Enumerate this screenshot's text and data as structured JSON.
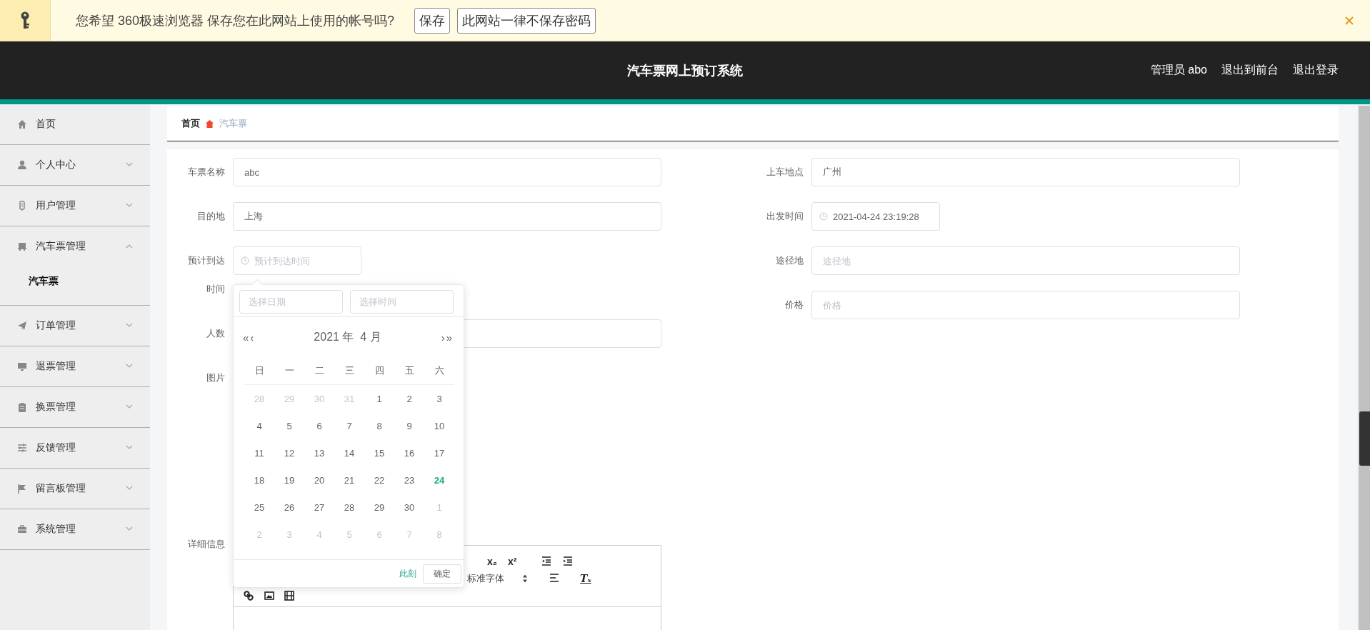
{
  "password_bar": {
    "message": "您希望 360极速浏览器 保存您在此网站上使用的帐号吗?",
    "buttons": [
      "保存",
      "此网站一律不保存密码"
    ]
  },
  "header": {
    "title": "汽车票网上预订系统",
    "links": [
      "管理员 abo",
      "退出到前台",
      "退出登录"
    ]
  },
  "sidebar": {
    "items": [
      {
        "label": "首页",
        "kind": "link"
      },
      {
        "label": "个人中心",
        "kind": "menu",
        "expanded": false
      },
      {
        "label": "用户管理",
        "kind": "menu",
        "expanded": false
      },
      {
        "label": "汽车票管理",
        "kind": "menu",
        "expanded": true,
        "children": [
          {
            "label": "汽车票"
          }
        ]
      },
      {
        "label": "订单管理",
        "kind": "menu",
        "expanded": false
      },
      {
        "label": "退票管理",
        "kind": "menu",
        "expanded": false
      },
      {
        "label": "换票管理",
        "kind": "menu",
        "expanded": false
      },
      {
        "label": "反馈管理",
        "kind": "menu",
        "expanded": false
      },
      {
        "label": "留言板管理",
        "kind": "menu",
        "expanded": false
      },
      {
        "label": "系统管理",
        "kind": "menu",
        "expanded": false
      }
    ]
  },
  "breadcrumb": [
    "首页",
    "汽车票"
  ],
  "form": {
    "left": [
      {
        "label": "车票名称",
        "kind": "text",
        "value": "abc"
      },
      {
        "label": "目的地",
        "kind": "text",
        "value": "上海"
      },
      {
        "label": "预计到达时间",
        "kind": "datetime",
        "placeholder": "预计到达时间",
        "picker": {
          "date_placeholder": "选择日期",
          "time_placeholder": "选择时间",
          "nav_back": [
            "«",
            "‹"
          ],
          "title": "2021 年  4 月",
          "nav_forward": [
            "›",
            "»"
          ],
          "weekdays": [
            "日",
            "一",
            "二",
            "三",
            "四",
            "五",
            "六"
          ],
          "days": [
            {
              "day": "28",
              "muted": true,
              "selected": false
            },
            {
              "day": "29",
              "muted": true,
              "selected": false
            },
            {
              "day": "30",
              "muted": true,
              "selected": false
            },
            {
              "day": "31",
              "muted": true,
              "selected": false
            },
            {
              "day": "1",
              "muted": false,
              "selected": false
            },
            {
              "day": "2",
              "muted": false,
              "selected": false
            },
            {
              "day": "3",
              "muted": false,
              "selected": false
            },
            {
              "day": "4",
              "muted": false,
              "selected": false
            },
            {
              "day": "5",
              "muted": false,
              "selected": false
            },
            {
              "day": "6",
              "muted": false,
              "selected": false
            },
            {
              "day": "7",
              "muted": false,
              "selected": false
            },
            {
              "day": "8",
              "muted": false,
              "selected": false
            },
            {
              "day": "9",
              "muted": false,
              "selected": false
            },
            {
              "day": "10",
              "muted": false,
              "selected": false
            },
            {
              "day": "11",
              "muted": false,
              "selected": false
            },
            {
              "day": "12",
              "muted": false,
              "selected": false
            },
            {
              "day": "13",
              "muted": false,
              "selected": false
            },
            {
              "day": "14",
              "muted": false,
              "selected": false
            },
            {
              "day": "15",
              "muted": false,
              "selected": false
            },
            {
              "day": "16",
              "muted": false,
              "selected": false
            },
            {
              "day": "17",
              "muted": false,
              "selected": false
            },
            {
              "day": "18",
              "muted": false,
              "selected": false
            },
            {
              "day": "19",
              "muted": false,
              "selected": false
            },
            {
              "day": "20",
              "muted": false,
              "selected": false
            },
            {
              "day": "21",
              "muted": false,
              "selected": false
            },
            {
              "day": "22",
              "muted": false,
              "selected": false
            },
            {
              "day": "23",
              "muted": false,
              "selected": false
            },
            {
              "day": "24",
              "muted": false,
              "selected": true
            },
            {
              "day": "25",
              "muted": false,
              "selected": false
            },
            {
              "day": "26",
              "muted": false,
              "selected": false
            },
            {
              "day": "27",
              "muted": false,
              "selected": false
            },
            {
              "day": "28",
              "muted": false,
              "selected": false
            },
            {
              "day": "29",
              "muted": false,
              "selected": false
            },
            {
              "day": "30",
              "muted": false,
              "selected": false
            },
            {
              "day": "1",
              "muted": true,
              "selected": false
            },
            {
              "day": "2",
              "muted": true,
              "selected": false
            },
            {
              "day": "3",
              "muted": true,
              "selected": false
            },
            {
              "day": "4",
              "muted": true,
              "selected": false
            },
            {
              "day": "5",
              "muted": true,
              "selected": false
            },
            {
              "day": "6",
              "muted": true,
              "selected": false
            },
            {
              "day": "7",
              "muted": true,
              "selected": false
            },
            {
              "day": "8",
              "muted": true,
              "selected": false
            }
          ],
          "now_link": "此刻",
          "confirm": "确定"
        }
      },
      {
        "label": "人数",
        "kind": "text"
      },
      {
        "label": "图片",
        "kind": "upload"
      },
      {
        "label": "详细信息",
        "kind": "editor",
        "toolbar": {
          "subscript": "x₂",
          "superscript": "x²",
          "font": "标准字体",
          "clear_format": "Tₓ"
        }
      }
    ],
    "right": [
      {
        "label": "上车地点",
        "kind": "text",
        "value": "广州"
      },
      {
        "label": "出发时间",
        "kind": "datetime",
        "value": "2021-04-24 23:19:28"
      },
      {
        "label": "途径地",
        "kind": "text",
        "placeholder": "途径地"
      },
      {
        "label": "价格",
        "kind": "text",
        "placeholder": "价格"
      }
    ]
  }
}
